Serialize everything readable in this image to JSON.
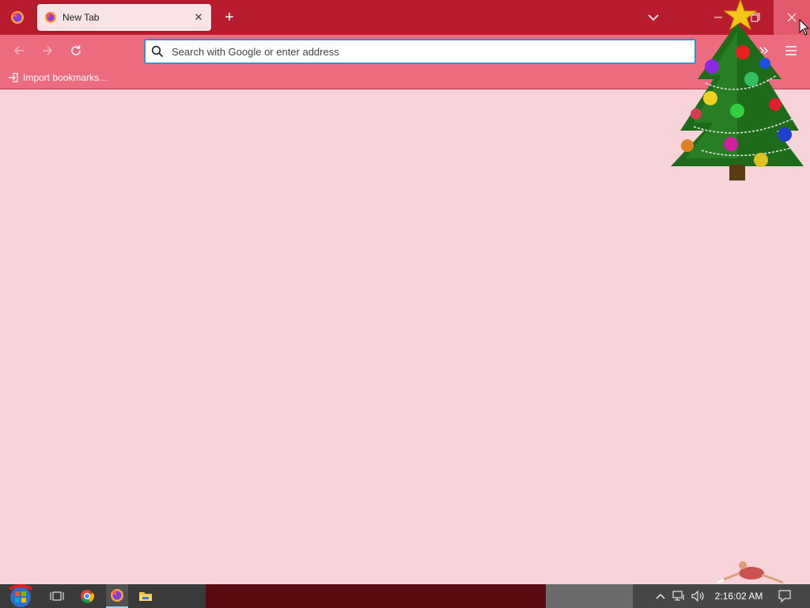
{
  "tab": {
    "title": "New Tab",
    "close_glyph": "✕"
  },
  "newtab": {
    "glyph": "+"
  },
  "urlbar": {
    "placeholder": "Search with Google or enter address",
    "value": ""
  },
  "bookmarks": {
    "import_label": "Import bookmarks..."
  },
  "taskbar": {
    "clock": "2:16:02 AM"
  },
  "colors": {
    "tabstrip": "#b91c2c",
    "toolbar": "#ed6b7e",
    "content": "#f8d4da",
    "urlbar_focus": "#2b95c9"
  },
  "icons": {
    "firefox_menu": "firefox-logo-icon",
    "tab_favicon": "firefox-favicon-icon",
    "back": "arrow-left-icon",
    "forward": "arrow-right-icon",
    "reload": "reload-icon",
    "search": "search-icon",
    "extensions": "chevron-double-right-icon",
    "menu": "hamburger-menu-icon",
    "list_tabs": "chevron-down-icon",
    "import": "import-icon"
  }
}
